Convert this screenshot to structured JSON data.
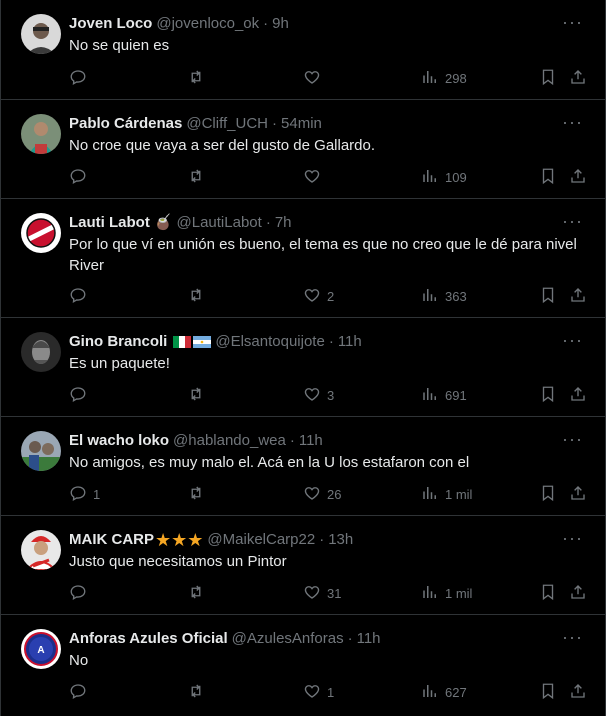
{
  "colors": {
    "background": "#000000",
    "text": "#e7e9ea",
    "muted": "#71767b",
    "border": "#2f3336",
    "star": "#f5a623"
  },
  "tweets": [
    {
      "name": "Joven Loco",
      "handle": "@jovenloco_ok",
      "dot": "·",
      "time": "9h",
      "text": "No se quien es",
      "replies": "",
      "retweets": "",
      "likes": "",
      "views": "298"
    },
    {
      "name": "Pablo Cárdenas",
      "handle": "@Cliff_UCH",
      "dot": "·",
      "time": "54min",
      "text": "No croe que vaya a ser del gusto de Gallardo.",
      "replies": "",
      "retweets": "",
      "likes": "",
      "views": "109"
    },
    {
      "name": "Lauti Labot",
      "emoji": "🧉",
      "handle": "@LautiLabot",
      "dot": "·",
      "time": "7h",
      "text": "Por lo que ví en unión es bueno, el tema es que no creo que le dé para nivel River",
      "replies": "",
      "retweets": "",
      "likes": "2",
      "views": "363"
    },
    {
      "name": "Gino Brancoli",
      "flags": [
        "italy-flag",
        "argentina-flag"
      ],
      "handle": "@Elsantoquijote",
      "dot": "·",
      "time": "11h",
      "text": "Es un paquete!",
      "replies": "",
      "retweets": "",
      "likes": "3",
      "views": "691"
    },
    {
      "name": "El wacho loko",
      "handle": "@hablando_wea",
      "dot": "·",
      "time": "11h",
      "text": "No amigos, es muy malo el. Acá en la U los estafaron con el",
      "replies": "1",
      "retweets": "",
      "likes": "26",
      "views": "1 mil"
    },
    {
      "name": "MAIK CARP",
      "stars": "★★★",
      "handle": "@MaikelCarp22",
      "dot": "·",
      "time": "13h",
      "text": "Justo que necesitamos un Pintor",
      "replies": "",
      "retweets": "",
      "likes": "31",
      "views": "1 mil"
    },
    {
      "name": "Anforas Azules Oficial",
      "handle": "@AzulesAnforas",
      "dot": "·",
      "time": "11h",
      "text": "No",
      "replies": "",
      "retweets": "",
      "likes": "1",
      "views": "627"
    }
  ],
  "icons": {
    "reply": "reply-icon",
    "retweet": "retweet-icon",
    "like": "heart-icon",
    "views": "views-icon",
    "bookmark": "bookmark-icon",
    "share": "share-icon",
    "more": "more-icon"
  },
  "more_label": "···"
}
